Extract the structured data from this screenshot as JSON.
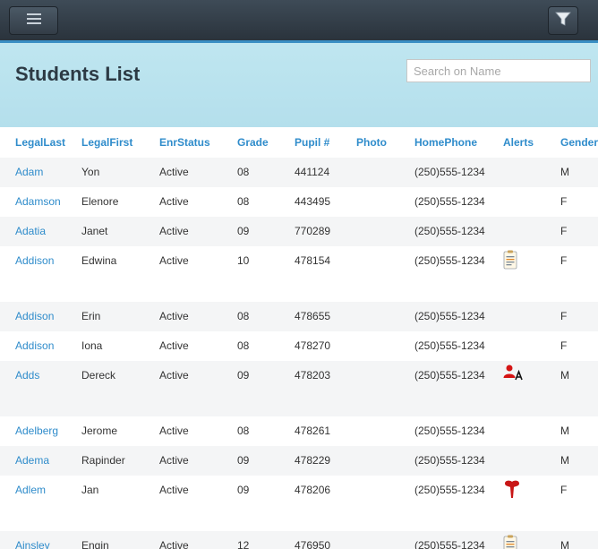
{
  "page": {
    "title": "Students List"
  },
  "search": {
    "placeholder": "Search on Name",
    "value": ""
  },
  "icons": {
    "menu": "hamburger-icon",
    "filter": "filter-funnel-icon"
  },
  "table": {
    "headers": [
      "LegalLast",
      "LegalFirst",
      "EnrStatus",
      "Grade",
      "Pupil #",
      "Photo",
      "HomePhone",
      "Alerts",
      "Gender"
    ],
    "rows": [
      {
        "last": "Adam",
        "first": "Yon",
        "status": "Active",
        "grade": "08",
        "pupil": "441124",
        "photo": "",
        "phone": "(250)555-1234",
        "alert": "",
        "gender": "M"
      },
      {
        "last": "Adamson",
        "first": "Elenore",
        "status": "Active",
        "grade": "08",
        "pupil": "443495",
        "photo": "",
        "phone": "(250)555-1234",
        "alert": "",
        "gender": "F"
      },
      {
        "last": "Adatia",
        "first": "Janet",
        "status": "Active",
        "grade": "09",
        "pupil": "770289",
        "photo": "",
        "phone": "(250)555-1234",
        "alert": "",
        "gender": "F"
      },
      {
        "last": "Addison",
        "first": "Edwina",
        "status": "Active",
        "grade": "10",
        "pupil": "478154",
        "photo": "",
        "phone": "(250)555-1234",
        "alert": "notes-clipboard-icon",
        "gender": "F"
      },
      {
        "last": "Addison",
        "first": "Erin",
        "status": "Active",
        "grade": "08",
        "pupil": "478655",
        "photo": "",
        "phone": "(250)555-1234",
        "alert": "",
        "gender": "F"
      },
      {
        "last": "Addison",
        "first": "Iona",
        "status": "Active",
        "grade": "08",
        "pupil": "478270",
        "photo": "",
        "phone": "(250)555-1234",
        "alert": "",
        "gender": "F"
      },
      {
        "last": "Adds",
        "first": "Dereck",
        "status": "Active",
        "grade": "09",
        "pupil": "478203",
        "photo": "",
        "phone": "(250)555-1234",
        "alert": "person-alert-icon",
        "gender": "M"
      },
      {
        "last": "Adelberg",
        "first": "Jerome",
        "status": "Active",
        "grade": "08",
        "pupil": "478261",
        "photo": "",
        "phone": "(250)555-1234",
        "alert": "",
        "gender": "M"
      },
      {
        "last": "Adema",
        "first": "Rapinder",
        "status": "Active",
        "grade": "09",
        "pupil": "478229",
        "photo": "",
        "phone": "(250)555-1234",
        "alert": "",
        "gender": "M"
      },
      {
        "last": "Adlem",
        "first": "Jan",
        "status": "Active",
        "grade": "09",
        "pupil": "478206",
        "photo": "",
        "phone": "(250)555-1234",
        "alert": "medical-tooth-icon",
        "gender": "F"
      },
      {
        "last": "Ainsley",
        "first": "Engin",
        "status": "Active",
        "grade": "12",
        "pupil": "476950",
        "photo": "",
        "phone": "(250)555-1234",
        "alert": "notes-clipboard-icon",
        "gender": "M"
      }
    ]
  }
}
